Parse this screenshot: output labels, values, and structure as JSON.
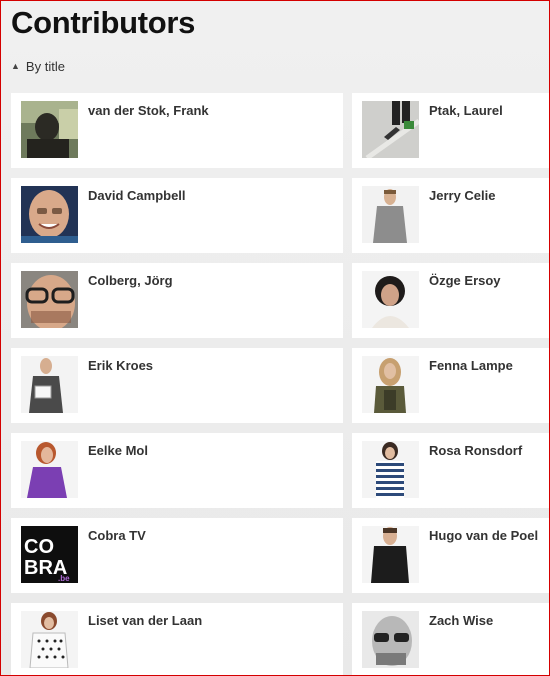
{
  "header": {
    "title": "Contributors",
    "sort_label": "By title"
  },
  "contributors": [
    {
      "name": "van der Stok, Frank",
      "photo": "silhouette-window-photo"
    },
    {
      "name": "Ptak, Laurel",
      "photo": "legs-on-floor-photo"
    },
    {
      "name": "David Campbell",
      "photo": "smiling-man-portrait"
    },
    {
      "name": "Jerry Celie",
      "photo": "man-grey-shirt-portrait"
    },
    {
      "name": "Colberg, Jörg",
      "photo": "man-glasses-portrait"
    },
    {
      "name": "Özge Ersoy",
      "photo": "woman-dark-hair-portrait"
    },
    {
      "name": "Erik Kroes",
      "photo": "man-holding-paper-portrait"
    },
    {
      "name": "Fenna Lampe",
      "photo": "woman-blonde-portrait"
    },
    {
      "name": "Eelke Mol",
      "photo": "woman-purple-shirt-portrait"
    },
    {
      "name": "Rosa Ronsdorf",
      "photo": "woman-striped-shirt-portrait"
    },
    {
      "name": "Cobra TV",
      "photo": "cobra-logo",
      "logo_text": "COBRA",
      "logo_suffix": ".be"
    },
    {
      "name": "Hugo van de Poel",
      "photo": "man-black-sweater-portrait"
    },
    {
      "name": "Liset van der Laan",
      "photo": "woman-dotted-shirt-portrait"
    },
    {
      "name": "Zach Wise",
      "photo": "man-sunglasses-portrait"
    }
  ]
}
